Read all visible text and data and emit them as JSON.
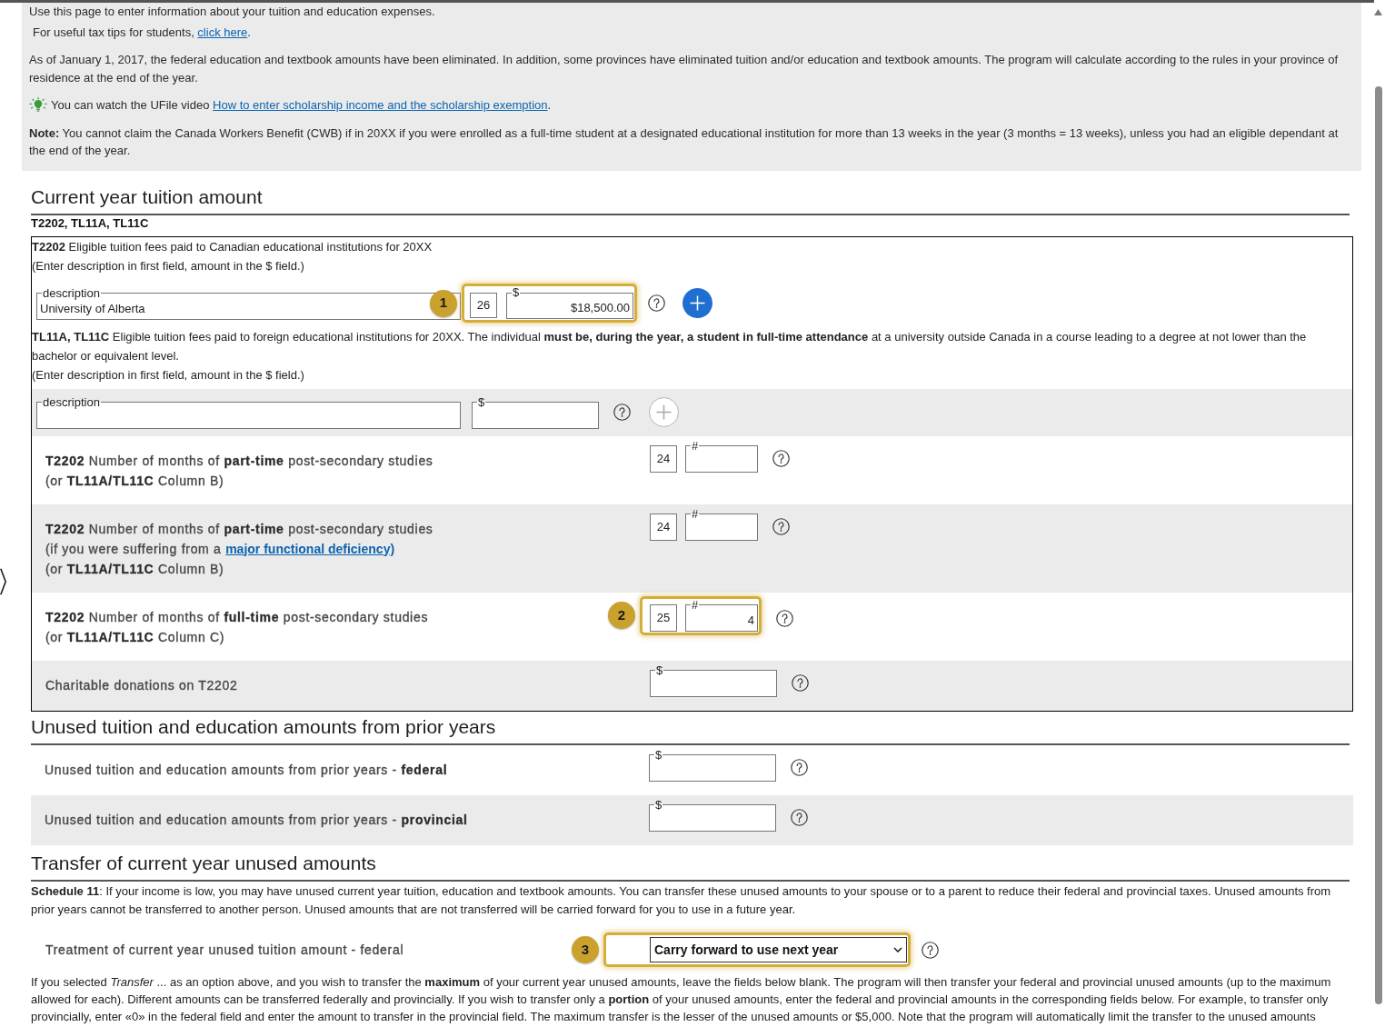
{
  "info": {
    "paragraphs": [
      {
        "kind": "plain",
        "text": "Use this page to enter information about your tuition and education expenses."
      },
      {
        "kind": "link",
        "text": "For useful tax tips for students,",
        "link": "click here",
        "after": "."
      },
      {
        "kind": "plain",
        "text": "As of January 1, 2017, the federal education and textbook amounts have been eliminated. In addition, some provinces have eliminated tuition and/or education and textbook amounts. The program will calculate according to the rules in your province of residence at the end of the year."
      },
      {
        "kind": "tip",
        "text": "You can watch the UFile video",
        "link": "How to enter scholarship income and the scholarship exemption",
        "after": "."
      },
      {
        "kind": "plain",
        "text": "**Note:** You cannot claim the Canada Workers Benefit (CWB) if in 20XX if you were enrolled as a full-time student at a designated educational institution for more than 13 weeks in the year (3 months = 13 weeks), unless you had an eligible dependant at the end of the year."
      }
    ]
  },
  "tuition": {
    "title": "Current year tuition amount",
    "subtitle": "T2202, TL11A, TL11C",
    "items": [
      {
        "kind": "text",
        "lines": [
          "**T2202** Eligible tuition fees paid to Canadian educational institutions for 20XX",
          "(Enter description in first field, amount in the $ field.)"
        ]
      },
      {
        "kind": "entry",
        "description": {
          "legend": "description",
          "value": "University of Alberta"
        },
        "callout": "1",
        "code": "26",
        "amount": {
          "legend": "$",
          "value": "$18,500.00"
        },
        "add_disabled": false
      },
      {
        "kind": "text",
        "lines": [
          "**TL11A, TL11C** Eligible tuition fees paid to foreign educational institutions for 20XX. The individual **must be, during the year, a student in full-time attendance** at a university outside Canada in a course leading to a degree at not lower than the bachelor or equivalent level.",
          "(Enter description in first field, amount in the $ field.)"
        ]
      },
      {
        "kind": "entry",
        "description": {
          "legend": "description"
        },
        "amount": {
          "legend": "$"
        },
        "add_disabled": true
      },
      {
        "kind": "count",
        "label": [
          {
            "text": "**T2202** Number of months of **part-time** post-secondary studies"
          },
          {
            "text": "(or **TL11A/TL11C** Column B)"
          }
        ],
        "code": "24",
        "field": {
          "legend": "#"
        }
      },
      {
        "kind": "count",
        "label": [
          {
            "text": "**T2202** Number of months of **part-time** post-secondary studies"
          },
          {
            "text": "(if you were suffering from a",
            "link": "major functional deficiency)"
          },
          {
            "text": "(or **TL11A/TL11C** Column B)"
          }
        ],
        "code": "24",
        "field": {
          "legend": "#"
        }
      },
      {
        "kind": "count",
        "label": [
          {
            "text": "**T2202** Number of months of **full-time** post-secondary studies"
          },
          {
            "text": "(or **TL11A/TL11C** Column C)"
          }
        ],
        "callout": "2",
        "code": "25",
        "field": {
          "legend": "#",
          "value": "4"
        }
      },
      {
        "kind": "amount",
        "label": [
          {
            "text": "Charitable donations on T2202"
          }
        ],
        "field": {
          "legend": "$"
        }
      }
    ]
  },
  "unused": {
    "title": "Unused tuition and education amounts from prior years",
    "rows": [
      {
        "kind": "amount",
        "label": [
          {
            "text": "Unused tuition and education amounts from prior years - **federal**"
          }
        ],
        "field": {
          "legend": "$"
        }
      },
      {
        "kind": "amount",
        "label": [
          {
            "text": "Unused tuition and education amounts from prior years - **provincial**"
          }
        ],
        "field": {
          "legend": "$"
        }
      }
    ]
  },
  "transfer": {
    "title": "Transfer of current year unused amounts",
    "intro": "**Schedule 11**: If your income is low, you may have unused current year tuition, education and textbook amounts. You can transfer these unused amounts to your spouse or to a parent to reduce their federal and provincial taxes. Unused amounts from prior years cannot be transferred to another person. Unused amounts that are not transferred will be carried forward for you to use in a future year.",
    "rows": [
      {
        "kind": "select",
        "label": [
          {
            "text": "Treatment of current year unused tuition amount - federal"
          }
        ],
        "callout": "3",
        "value": "Carry forward to use next year"
      }
    ],
    "note": "If you selected *Transfer* ... as an option above, and you wish to transfer the **maximum** of your current year unused amounts, leave the fields below blank. The program will then transfer your federal and provincial unused amounts (up to the maximum allowed for each). Different amounts can be transferred federally and provincially. If you wish to transfer only a **portion** of your unused amounts, enter the federal and provincial amounts in the corresponding fields below. For example, to transfer only provincially, enter «0» in the federal field and enter the amount to transfer in the provincial field. The maximum transfer is the lesser of the unused amounts or $5,000. Note that the program will automatically limit the transfer to the unused amounts"
  }
}
